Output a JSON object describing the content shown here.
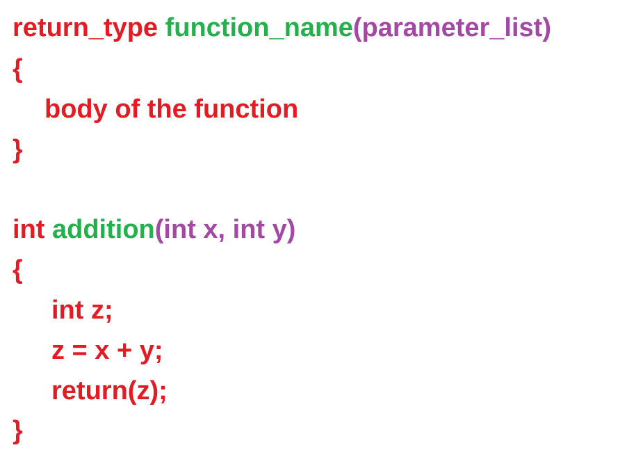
{
  "colors": {
    "return_type": "#e31b23",
    "function_name": "#22b14c",
    "parameters": "#a349a4",
    "body": "#e31b23",
    "background": "#ffffff"
  },
  "generic": {
    "return_type": "return_type",
    "function_name": "function_name",
    "params": "(parameter_list)",
    "open_brace": "{",
    "body": "body of the function",
    "close_brace": "}"
  },
  "example": {
    "return_type": "int",
    "function_name": "addition",
    "params": "(int x, int y)",
    "open_brace": "{",
    "body_lines": [
      "int z;",
      "z = x + y;",
      "return(z);"
    ],
    "close_brace": "}"
  }
}
